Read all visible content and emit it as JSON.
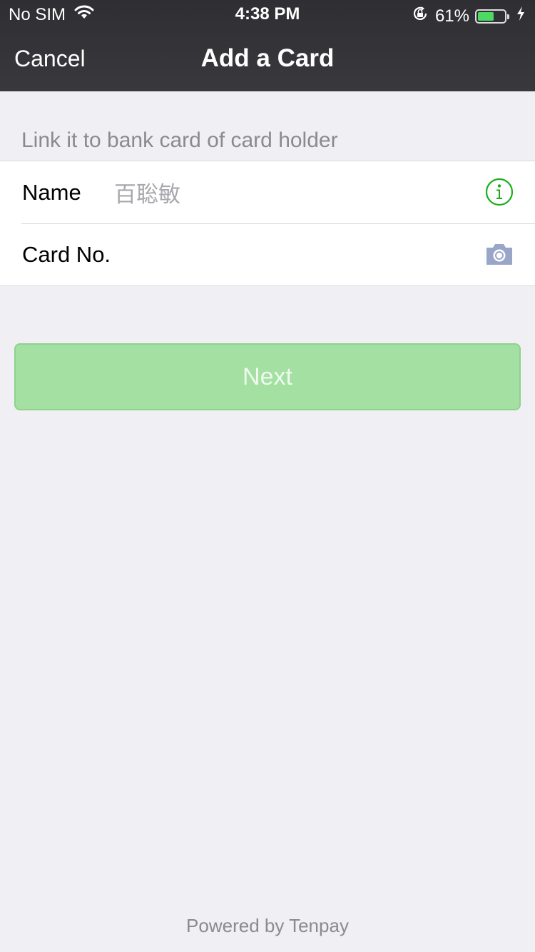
{
  "status_bar": {
    "carrier": "No SIM",
    "time": "4:38 PM",
    "battery_percent": "61%",
    "battery_level": 0.61,
    "wifi_icon": "wifi-icon",
    "rotation_lock_icon": "rotation-lock-icon",
    "charging_icon": "charging-bolt-icon"
  },
  "nav": {
    "cancel_label": "Cancel",
    "title": "Add a Card"
  },
  "form": {
    "section_header": "Link it to bank card of card holder",
    "name_label": "Name",
    "name_value": "百聡敏",
    "name_info_icon": "info-icon",
    "card_label": "Card No.",
    "card_value": "",
    "card_camera_icon": "camera-icon"
  },
  "actions": {
    "next_label": "Next"
  },
  "footer": {
    "powered_by": "Powered by Tenpay"
  },
  "colors": {
    "nav_background": "#35353a",
    "accent_green": "#1aad19",
    "next_button_disabled": "#a3e0a2",
    "camera_icon": "#9aa6c8",
    "page_background": "#efeff4"
  }
}
